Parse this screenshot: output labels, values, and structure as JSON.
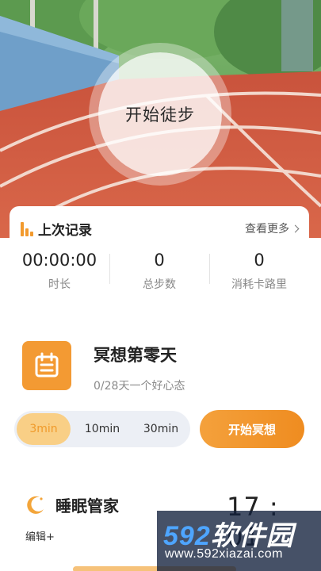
{
  "hero": {
    "start_walk_label": "开始徒步"
  },
  "last_record": {
    "title": "上次记录",
    "more_label": "查看更多",
    "stats": [
      {
        "value": "00:00:00",
        "label": "时长"
      },
      {
        "value": "0",
        "label": "总步数"
      },
      {
        "value": "0",
        "label": "消耗卡路里"
      }
    ]
  },
  "meditation": {
    "icon": "calendar-icon",
    "title": "冥想第零天",
    "subtitle": "0/28天一个好心态",
    "durations": [
      "3min",
      "10min",
      "30min"
    ],
    "selected_duration": "3min",
    "start_label": "开始冥想",
    "accent_color": "#f39a33"
  },
  "sleep": {
    "icon": "moon-icon",
    "title": "睡眠管家",
    "edit_label": "编辑+",
    "time": "17 : 01"
  },
  "watermark": {
    "logo_num": "592",
    "logo_text": "软件园",
    "url": "www.592xiazai.com"
  }
}
